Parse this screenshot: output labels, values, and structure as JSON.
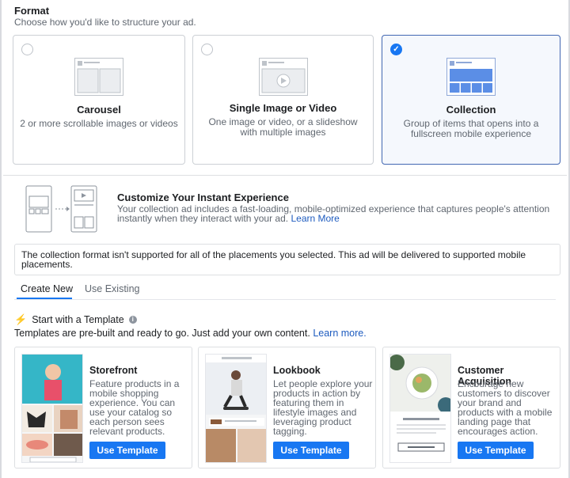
{
  "format": {
    "title": "Format",
    "subtitle": "Choose how you'd like to structure your ad.",
    "options": [
      {
        "title": "Carousel",
        "description": "2 or more scrollable images or videos",
        "selected": false
      },
      {
        "title": "Single Image or Video",
        "description": "One image or video, or a slideshow with multiple images",
        "selected": false
      },
      {
        "title": "Collection",
        "description": "Group of items that opens into a fullscreen mobile experience",
        "selected": true
      }
    ]
  },
  "instant_experience": {
    "title": "Customize Your Instant Experience",
    "description": "Your collection ad includes a fast-loading, mobile-optimized experience that captures people's attention instantly when they interact with your ad.",
    "link": "Learn More"
  },
  "notice": "The collection format isn't supported for all of the placements you selected. This ad will be delivered to supported mobile placements.",
  "tabs": [
    {
      "label": "Create New",
      "active": true
    },
    {
      "label": "Use Existing",
      "active": false
    }
  ],
  "templates": {
    "heading": "Start with a Template",
    "subtitle": "Templates are pre-built and ready to go. Just add your own content.",
    "subtitle_link": "Learn more.",
    "cards": [
      {
        "title": "Storefront",
        "description": "Feature products in a mobile shopping experience. You can use your catalog so each person sees relevant products.",
        "button": "Use Template",
        "icon": "storefront-preview-image"
      },
      {
        "title": "Lookbook",
        "description": "Let people explore your products in action by featuring them in lifestyle images and leveraging product tagging.",
        "button": "Use Template",
        "icon": "lookbook-preview-image"
      },
      {
        "title": "Customer Acquisition",
        "description": "Encourage new customers to discover your brand and products with a mobile landing page that encourages action.",
        "button": "Use Template",
        "icon": "customer-acquisition-preview-image"
      }
    ]
  },
  "colors": {
    "accent": "#1877f2",
    "selected_border": "#4267b2",
    "link": "#1d5bbf"
  }
}
